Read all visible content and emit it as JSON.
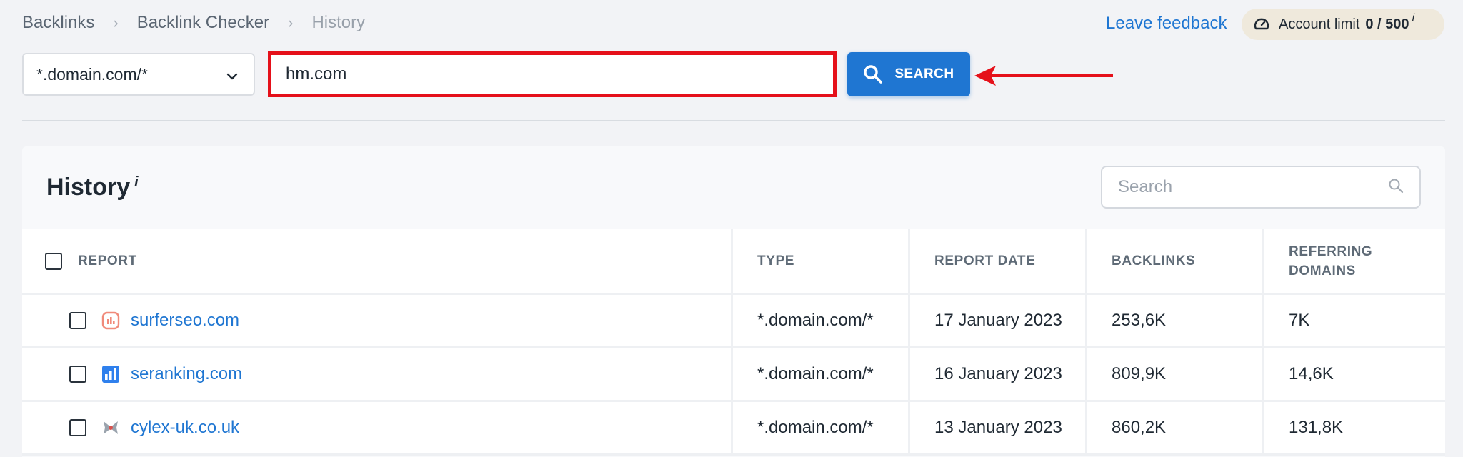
{
  "breadcrumb": {
    "items": [
      "Backlinks",
      "Backlink Checker",
      "History"
    ],
    "separator": "›"
  },
  "header": {
    "feedback_label": "Leave feedback",
    "account_limit_label": "Account limit",
    "account_limit_value": "0 / 500",
    "info_marker": "i"
  },
  "search_bar": {
    "mode_value": "*.domain.com/*",
    "query_value": "hm.com",
    "button_label": "SEARCH",
    "highlight_color": "#e5101a",
    "button_color": "#1f76d2"
  },
  "history": {
    "title": "History",
    "info_marker": "i",
    "search_placeholder": "Search",
    "columns": [
      "REPORT",
      "TYPE",
      "REPORT DATE",
      "BACKLINKS",
      "REFERRING DOMAINS"
    ],
    "rows": [
      {
        "report": "surferseo.com",
        "icon": "surferseo-favicon-icon",
        "type": "*.domain.com/*",
        "date": "17 January 2023",
        "backlinks": "253,6K",
        "referring_domains": "7K"
      },
      {
        "report": "seranking.com",
        "icon": "seranking-favicon-icon",
        "type": "*.domain.com/*",
        "date": "16 January 2023",
        "backlinks": "809,9K",
        "referring_domains": "14,6K"
      },
      {
        "report": "cylex-uk.co.uk",
        "icon": "cylex-favicon-icon",
        "type": "*.domain.com/*",
        "date": "13 January 2023",
        "backlinks": "860,2K",
        "referring_domains": "131,8K"
      }
    ]
  }
}
